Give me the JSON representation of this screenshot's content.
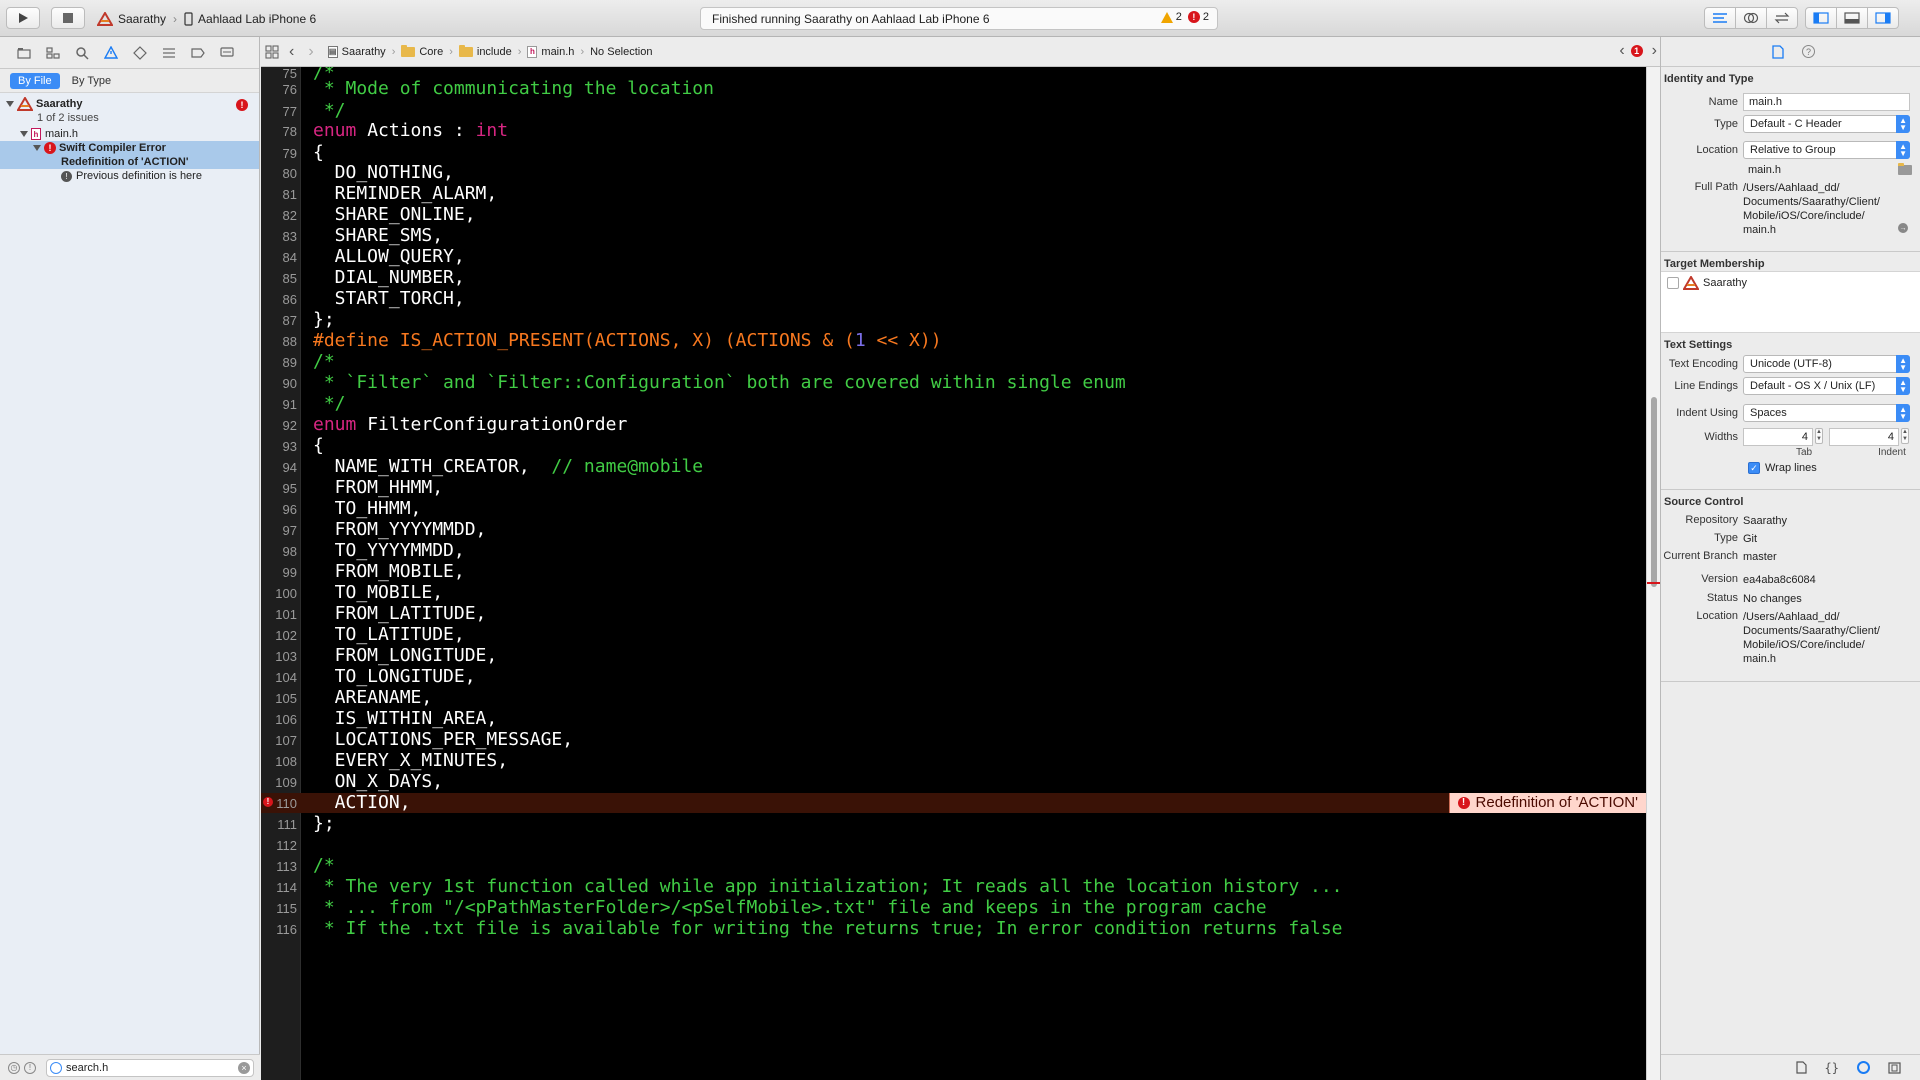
{
  "toolbar": {
    "scheme": "Saarathy",
    "device": "Aahlaad Lab iPhone 6",
    "activity": "Finished running Saarathy on Aahlaad Lab iPhone 6",
    "warnings": "2",
    "errors": "2"
  },
  "navigator": {
    "scope_by_file": "By File",
    "scope_by_type": "By Type",
    "project": "Saarathy",
    "project_issues": "1 of 2 issues",
    "file": "main.h",
    "issue_title": "Swift Compiler Error",
    "issue_message": "Redefinition of 'ACTION'",
    "issue_note": "Previous definition is here",
    "filter_value": "search.h"
  },
  "jumpbar": {
    "crumbs": [
      "Saarathy",
      "Core",
      "include",
      "main.h",
      "No Selection"
    ],
    "error_count": "1"
  },
  "editor": {
    "error_annotation": "Redefinition of 'ACTION'",
    "lines": [
      {
        "n": "75",
        "code": "/*"
      },
      {
        "n": "76",
        "code": " * Mode of communicating the location"
      },
      {
        "n": "77",
        "code": " */"
      },
      {
        "n": "78",
        "code": "enum Actions : int"
      },
      {
        "n": "79",
        "code": "{"
      },
      {
        "n": "80",
        "code": "  DO_NOTHING,"
      },
      {
        "n": "81",
        "code": "  REMINDER_ALARM,"
      },
      {
        "n": "82",
        "code": "  SHARE_ONLINE,"
      },
      {
        "n": "83",
        "code": "  SHARE_SMS,"
      },
      {
        "n": "84",
        "code": "  ALLOW_QUERY,"
      },
      {
        "n": "85",
        "code": "  DIAL_NUMBER,"
      },
      {
        "n": "86",
        "code": "  START_TORCH,"
      },
      {
        "n": "87",
        "code": "};"
      },
      {
        "n": "88",
        "code": "#define IS_ACTION_PRESENT(ACTIONS, X) (ACTIONS & (1 << X))"
      },
      {
        "n": "89",
        "code": "/*"
      },
      {
        "n": "90",
        "code": " * `Filter` and `Filter::Configuration` both are covered within single enum"
      },
      {
        "n": "91",
        "code": " */"
      },
      {
        "n": "92",
        "code": "enum FilterConfigurationOrder"
      },
      {
        "n": "93",
        "code": "{"
      },
      {
        "n": "94",
        "code": "  NAME_WITH_CREATOR,  // name@mobile"
      },
      {
        "n": "95",
        "code": "  FROM_HHMM,"
      },
      {
        "n": "96",
        "code": "  TO_HHMM,"
      },
      {
        "n": "97",
        "code": "  FROM_YYYYMMDD,"
      },
      {
        "n": "98",
        "code": "  TO_YYYYMMDD,"
      },
      {
        "n": "99",
        "code": "  FROM_MOBILE,"
      },
      {
        "n": "100",
        "code": "  TO_MOBILE,"
      },
      {
        "n": "101",
        "code": "  FROM_LATITUDE,"
      },
      {
        "n": "102",
        "code": "  TO_LATITUDE,"
      },
      {
        "n": "103",
        "code": "  FROM_LONGITUDE,"
      },
      {
        "n": "104",
        "code": "  TO_LONGITUDE,"
      },
      {
        "n": "105",
        "code": "  AREANAME,"
      },
      {
        "n": "106",
        "code": "  IS_WITHIN_AREA,"
      },
      {
        "n": "107",
        "code": "  LOCATIONS_PER_MESSAGE,"
      },
      {
        "n": "108",
        "code": "  EVERY_X_MINUTES,"
      },
      {
        "n": "109",
        "code": "  ON_X_DAYS,"
      },
      {
        "n": "110",
        "code": "  ACTION,"
      },
      {
        "n": "111",
        "code": "};"
      },
      {
        "n": "112",
        "code": ""
      },
      {
        "n": "113",
        "code": "/*"
      },
      {
        "n": "114",
        "code": " * The very 1st function called while app initialization; It reads all the location history ..."
      },
      {
        "n": "115",
        "code": " * ... from \"/<pPathMasterFolder>/<pSelfMobile>.txt\" file and keeps in the program cache"
      },
      {
        "n": "116",
        "code": " * If the .txt file is available for writing the returns true; In error condition returns false"
      }
    ]
  },
  "inspector": {
    "identity_title": "Identity and Type",
    "name_label": "Name",
    "name_value": "main.h",
    "type_label": "Type",
    "type_value": "Default - C Header",
    "location_label": "Location",
    "location_value": "Relative to Group",
    "location_file": "main.h",
    "fullpath_label": "Full Path",
    "fullpath_value": [
      "/Users/Aahlaad_dd/",
      "Documents/Saarathy/Client/",
      "Mobile/iOS/Core/include/",
      "main.h"
    ],
    "target_title": "Target Membership",
    "target_name": "Saarathy",
    "text_title": "Text Settings",
    "encoding_label": "Text Encoding",
    "encoding_value": "Unicode (UTF-8)",
    "endings_label": "Line Endings",
    "endings_value": "Default - OS X / Unix (LF)",
    "indent_label": "Indent Using",
    "indent_value": "Spaces",
    "widths_label": "Widths",
    "tab_width": "4",
    "indent_width": "4",
    "tab_caption": "Tab",
    "indent_caption": "Indent",
    "wrap_label": "Wrap lines",
    "sc_title": "Source Control",
    "repo_label": "Repository",
    "repo_value": "Saarathy",
    "sctype_label": "Type",
    "sctype_value": "Git",
    "branch_label": "Current Branch",
    "branch_value": "master",
    "version_label": "Version",
    "version_value": "ea4aba8c6084",
    "status_label": "Status",
    "status_value": "No changes",
    "sclocation_label": "Location",
    "sclocation_value": [
      "/Users/Aahlaad_dd/",
      "Documents/Saarathy/Client/",
      "Mobile/iOS/Core/include/",
      "main.h"
    ]
  },
  "colors": {
    "comment": "#41cc45",
    "keyword": "#d72682",
    "preprocessor": "#f7781f",
    "number": "#7b6fe8",
    "accent": "#3b8cf6",
    "error": "#d8151b"
  },
  "icons": [
    "play-icon",
    "stop-icon",
    "warning-icon",
    "error-icon",
    "folder-icon",
    "header-file-icon",
    "file-inspector-icon",
    "help-icon"
  ]
}
